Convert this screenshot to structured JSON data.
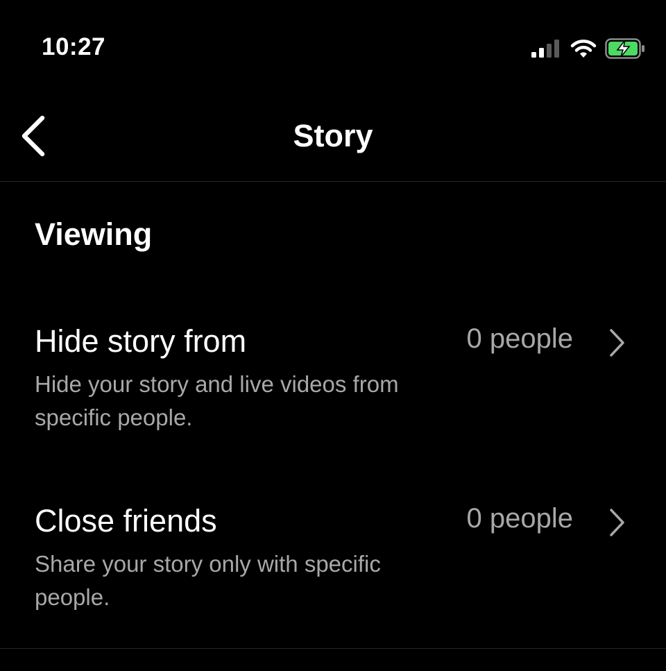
{
  "status_bar": {
    "time": "10:27",
    "signal_icon": "cellular-signal-icon",
    "wifi_icon": "wifi-icon",
    "battery_icon": "battery-charging-icon",
    "battery_color": "#4cd964"
  },
  "header": {
    "back_icon": "chevron-left-icon",
    "title": "Story"
  },
  "section": {
    "title": "Viewing"
  },
  "rows": [
    {
      "title": "Hide story from",
      "description": "Hide your story and live videos from specific people.",
      "value": "0 people",
      "chevron_icon": "chevron-right-icon"
    },
    {
      "title": "Close friends",
      "description": "Share your story only with specific people.",
      "value": "0 people",
      "chevron_icon": "chevron-right-icon"
    }
  ],
  "colors": {
    "background": "#000000",
    "text_primary": "#ffffff",
    "text_secondary": "#a8a8a8",
    "divider": "#262626"
  }
}
